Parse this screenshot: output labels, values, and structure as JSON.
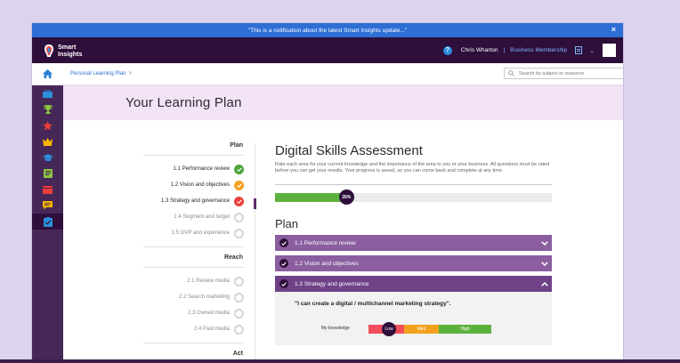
{
  "notification": {
    "text": "\"This is a notification about the latest Smart Insights update...\"",
    "close": "×"
  },
  "header": {
    "logo_line1": "Smart",
    "logo_line2": "Insights",
    "help": "?",
    "user_name": "Chris Wharton",
    "separator": "|",
    "membership": "Business Membership",
    "dropdown": "⌄"
  },
  "breadcrumb": {
    "item": "Personal Learning Plan",
    "arrow": ">"
  },
  "search": {
    "placeholder": "Search by subject or resource"
  },
  "sidebar": {
    "icons": [
      "briefcase-icon",
      "trophy-icon",
      "star-icon",
      "crown-icon",
      "graduation-cap-icon",
      "book-icon",
      "calendar-icon",
      "chat-icon",
      "checklist-icon"
    ],
    "colors": [
      "#2b8fdc",
      "#8cc63f",
      "#ef3e36",
      "#f7b500",
      "#2b8fdc",
      "#8cc63f",
      "#ef3e36",
      "#f7b500",
      "#2b8fdc"
    ],
    "active_index": 8
  },
  "page": {
    "title": "Your Learning Plan"
  },
  "nav": {
    "sections": [
      {
        "heading": "Plan",
        "items": [
          {
            "label": "1.1 Performance review",
            "status": "green",
            "dark": true
          },
          {
            "label": "1.2 Vision and objectives",
            "status": "orange",
            "dark": true
          },
          {
            "label": "1.3 Strategy and governance",
            "status": "red",
            "dark": true
          },
          {
            "label": "1.4 Segment and target",
            "status": "empty",
            "dark": false
          },
          {
            "label": "1.5 OVP and experience",
            "status": "empty",
            "dark": false
          }
        ]
      },
      {
        "heading": "Reach",
        "items": [
          {
            "label": "2.1 Review media",
            "status": "empty",
            "dark": false
          },
          {
            "label": "2.2 Search marketing",
            "status": "empty",
            "dark": false
          },
          {
            "label": "2.3 Owned media",
            "status": "empty",
            "dark": false
          },
          {
            "label": "2.4 Paid media",
            "status": "empty",
            "dark": false
          }
        ]
      },
      {
        "heading": "Act",
        "items": []
      }
    ]
  },
  "assessment": {
    "title": "Digital Skills Assessment",
    "description": "Rate each area for your current knowledge and the importance of the area to you or your business. All questions must be rated before you can get your results. Your progress is saved, so you can come back and complete at any time.",
    "progress_percent": 26,
    "progress_label": "26%",
    "section_title": "Plan",
    "accordion": [
      {
        "label": "1.1 Performance review",
        "open": false,
        "chevron": "⌄"
      },
      {
        "label": "1.2 Vision and objectives",
        "open": false,
        "chevron": "⌄"
      },
      {
        "label": "1.3 Strategy and governance",
        "open": true,
        "chevron": "⌃"
      }
    ],
    "question": "\"I can create a digital / multichannel marketing strategy\".",
    "knowledge_label": "My knowledge",
    "rating": {
      "low": "Low",
      "med": "Med",
      "high": "High",
      "selected": "low"
    }
  },
  "colors": {
    "brand_dark": "#2e0e3a",
    "accent_purple": "#8a5e9f",
    "notification_blue": "#2d6fd4",
    "green": "#5cb13d"
  }
}
